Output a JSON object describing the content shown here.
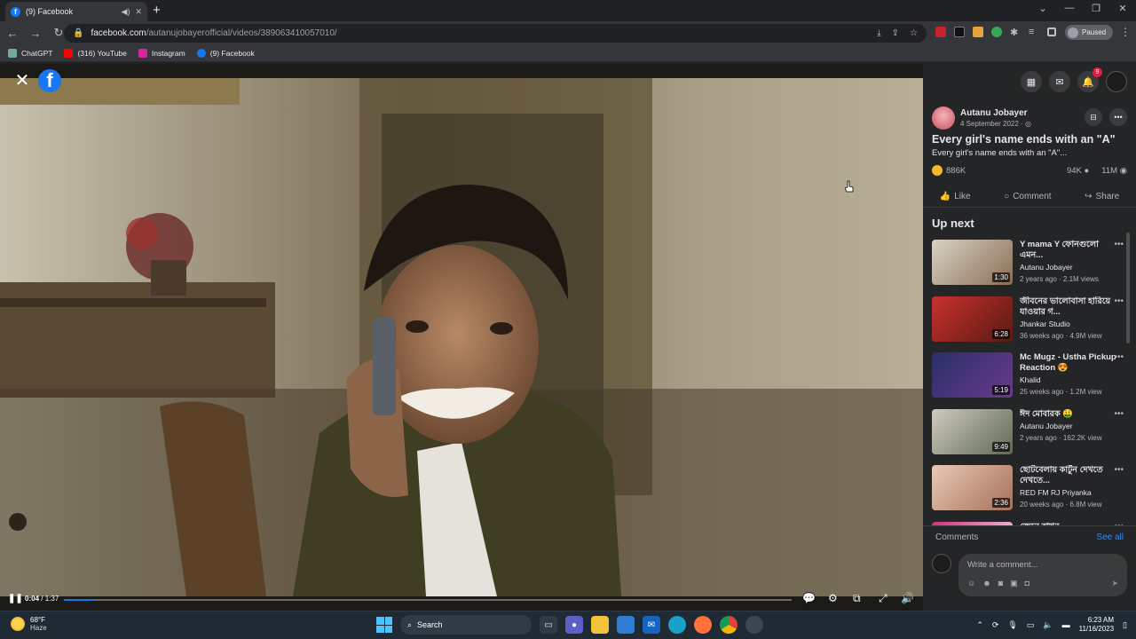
{
  "browser": {
    "tab_title": "(9) Facebook",
    "url_host": "facebook.com",
    "url_path": "/autanujobayerofficial/videos/389063410057010/",
    "paused_label": "Paused",
    "bookmarks": [
      {
        "label": "ChatGPT",
        "icon": "chatgpt-icon",
        "color": "#74aa9c"
      },
      {
        "label": "(316) YouTube",
        "icon": "youtube-icon",
        "color": "#ff0000"
      },
      {
        "label": "Instagram",
        "icon": "instagram-icon",
        "color": "#d6249f"
      },
      {
        "label": "(9) Facebook",
        "icon": "facebook-icon",
        "color": "#1877f2"
      }
    ]
  },
  "video": {
    "current_time": "0:04",
    "duration": "/ 1:37",
    "progress_fraction": 0.041
  },
  "sidebar": {
    "notification_count": "9",
    "author": "Autanu Jobayer",
    "date": "4 September 2022 · ",
    "title": "Every girl's name ends with an \"A\"",
    "description": "Every girl's name ends with an \"A\"...",
    "reactions": "886K",
    "comments_count": "94K",
    "views": "11M",
    "actions": {
      "like": "Like",
      "comment": "Comment",
      "share": "Share"
    },
    "up_next_label": "Up next",
    "up_next": [
      {
        "title": "Y mama Y ফোনগুলো এমন...",
        "channel": "Autanu Jobayer",
        "views": "2 years ago · 2.1M views",
        "duration": "1:30",
        "c1": "#d9d2c6",
        "c2": "#8a6e52"
      },
      {
        "title": "জীবনের ভালোবাসা হারিয়ে যাওয়ার গ...",
        "channel": "Jhankar Studio",
        "views": "36 weeks ago · 4.9M view",
        "duration": "6:28",
        "c1": "#c8312b",
        "c2": "#5a1a14"
      },
      {
        "title": "Mc Mugz - Ustha Pickup Reaction 😍",
        "channel": "Khalid",
        "views": "25 weeks ago · 1.2M view",
        "duration": "5:19",
        "c1": "#2a2f6a",
        "c2": "#6a3a8c"
      },
      {
        "title": "ঈদ মোবারক 🤑",
        "channel": "Autanu Jobayer",
        "views": "2 years ago · 162.2K view",
        "duration": "9:49",
        "c1": "#cfcac0",
        "c2": "#5d6a52"
      },
      {
        "title": "ছোটবেলায় কার্টুন দেখতে দেখতে...",
        "channel": "RED FM RJ Priyanka",
        "views": "20 weeks ago · 6.8M view",
        "duration": "2:36",
        "c1": "#e9c9b6",
        "c2": "#a5705a"
      },
      {
        "title": "জেনে রাখুন",
        "channel": "",
        "views": "",
        "duration": "",
        "c1": "#d62d7a",
        "c2": "#f4f4f4"
      }
    ],
    "comments_label": "Comments",
    "see_all": "See all",
    "comment_placeholder": "Write a comment..."
  },
  "taskbar": {
    "temp": "68°F",
    "weather": "Haze",
    "search": "Search",
    "time": "6:23 AM",
    "date": "11/16/2023"
  }
}
